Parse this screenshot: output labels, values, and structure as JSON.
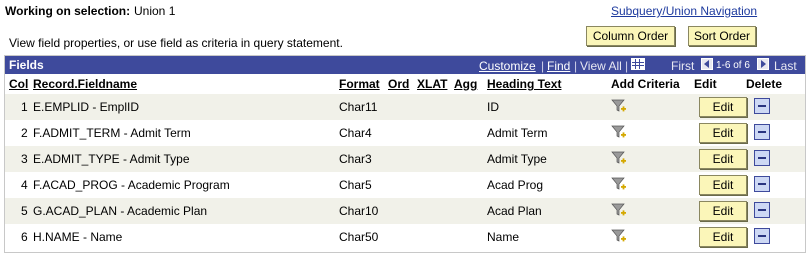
{
  "header": {
    "selection_label": "Working on selection:",
    "selection_value": "Union 1",
    "nav_link": "Subquery/Union Navigation",
    "instruction": "View field properties, or use field as criteria in query statement.",
    "column_order_button": "Column Order",
    "sort_order_button": "Sort Order"
  },
  "grid": {
    "title": "Fields",
    "customize": "Customize",
    "separator": "|",
    "find": "Find",
    "view_all": "View All",
    "first": "First",
    "range": "1-6 of 6",
    "last": "Last",
    "columns": {
      "col": "Col",
      "fieldname": "Record.Fieldname",
      "format": "Format",
      "ord": "Ord",
      "xlat": "XLAT",
      "agg": "Agg",
      "heading": "Heading Text",
      "criteria": "Add Criteria",
      "edit": "Edit",
      "delete": "Delete"
    },
    "rows": [
      {
        "col": "1",
        "fieldname": "E.EMPLID - EmplID",
        "format": "Char11",
        "heading": "ID",
        "edit": "Edit"
      },
      {
        "col": "2",
        "fieldname": "F.ADMIT_TERM - Admit Term",
        "format": "Char4",
        "heading": "Admit Term",
        "edit": "Edit"
      },
      {
        "col": "3",
        "fieldname": "E.ADMIT_TYPE - Admit Type",
        "format": "Char3",
        "heading": "Admit Type",
        "edit": "Edit"
      },
      {
        "col": "4",
        "fieldname": "F.ACAD_PROG - Academic Program",
        "format": "Char5",
        "heading": "Acad Prog",
        "edit": "Edit"
      },
      {
        "col": "5",
        "fieldname": "G.ACAD_PLAN - Academic Plan",
        "format": "Char10",
        "heading": "Acad Plan",
        "edit": "Edit"
      },
      {
        "col": "6",
        "fieldname": "H.NAME - Name",
        "format": "Char50",
        "heading": "Name",
        "edit": "Edit"
      }
    ]
  },
  "colors": {
    "grid_bar": "#3e4a9c",
    "button_bg": "#fbf6b9",
    "row_alt": "#f1f1e9",
    "link": "#1d3a9e"
  },
  "icons": {
    "criteria": "funnel-add-icon",
    "delete": "minus-icon",
    "first": "left-arrow-icon",
    "last": "right-arrow-icon",
    "view_all": "grid-view-icon"
  }
}
